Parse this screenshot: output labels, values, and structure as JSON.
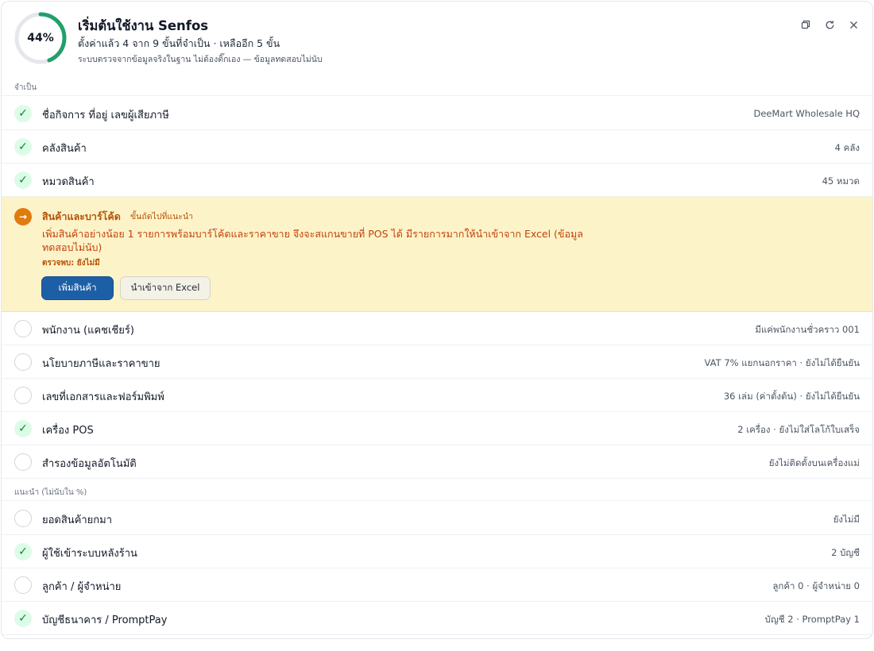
{
  "header": {
    "progress_percent": 44,
    "progress_label": "44%",
    "title": "เริ่มต้นใช้งาน Senfos",
    "subtitle": "ตั้งค่าแล้ว 4 จาก 9 ขั้นที่จำเป็น · เหลืออีก 5 ขั้น",
    "note": "ระบบตรวจจากข้อมูลจริงในฐาน ไม่ต้องติ๊กเอง — ข้อมูลทดสอบไม่นับ",
    "window_buttons": [
      "restore-icon",
      "refresh-icon",
      "close-icon"
    ]
  },
  "colors": {
    "progress": "#22a06b",
    "progress_track": "#e5e7eb",
    "done": "#15803d",
    "active": "#e07b0e",
    "active_bg": "#fdf3c8",
    "primary_button": "#1d5fa6"
  },
  "required": {
    "section_label": "จำเป็น",
    "rows_before": [
      {
        "label": "ชื่อกิจการ ที่อยู่ เลขผู้เสียภาษี",
        "value": "DeeMart Wholesale HQ",
        "status": "done"
      },
      {
        "label": "คลังสินค้า",
        "value": "4 คลัง",
        "status": "done"
      },
      {
        "label": "หมวดสินค้า",
        "value": "45 หมวด",
        "status": "done"
      }
    ],
    "active": {
      "label": "สินค้าและบาร์โค้ด",
      "tag": "ขั้นถัดไปที่แนะนำ",
      "description": "เพิ่มสินค้าอย่างน้อย 1 รายการพร้อมบาร์โค้ดและราคาขาย จึงจะสแกนขายที่ POS ได้ มีรายการมากให้นำเข้าจาก Excel (ข้อมูลทดสอบไม่นับ)",
      "found": "ตรวจพบ: ยังไม่มี",
      "primary_button": "เพิ่มสินค้า",
      "secondary_button": "นำเข้าจาก Excel",
      "status_icon": "arrow-right-icon"
    },
    "rows_after": [
      {
        "label": "พนักงาน (แคชเชียร์)",
        "value": "มีแค่พนักงานชั่วคราว 001",
        "status": "todo"
      },
      {
        "label": "นโยบายภาษีและราคาขาย",
        "value": "VAT 7% แยกนอกราคา · ยังไม่ได้ยืนยัน",
        "status": "todo"
      },
      {
        "label": "เลขที่เอกสารและฟอร์มพิมพ์",
        "value": "36 เล่ม (ค่าตั้งต้น) · ยังไม่ได้ยืนยัน",
        "status": "todo"
      },
      {
        "label": "เครื่อง POS",
        "value": "2 เครื่อง · ยังไม่ใส่โลโก้ใบเสร็จ",
        "status": "done"
      },
      {
        "label": "สำรองข้อมูลอัตโนมัติ",
        "value": "ยังไม่ติดตั้งบนเครื่องแม่",
        "status": "todo"
      }
    ]
  },
  "recommended": {
    "section_label": "แนะนำ (ไม่นับใน %)",
    "rows": [
      {
        "label": "ยอดสินค้ายกมา",
        "value": "ยังไม่มี",
        "status": "todo"
      },
      {
        "label": "ผู้ใช้เข้าระบบหลังร้าน",
        "value": "2 บัญชี",
        "status": "done"
      },
      {
        "label": "ลูกค้า / ผู้จำหน่าย",
        "value": "ลูกค้า 0 · ผู้จำหน่าย 0",
        "status": "todo"
      },
      {
        "label": "บัญชีธนาคาร / PromptPay",
        "value": "บัญชี 2 · PromptPay 1",
        "status": "done"
      }
    ]
  }
}
